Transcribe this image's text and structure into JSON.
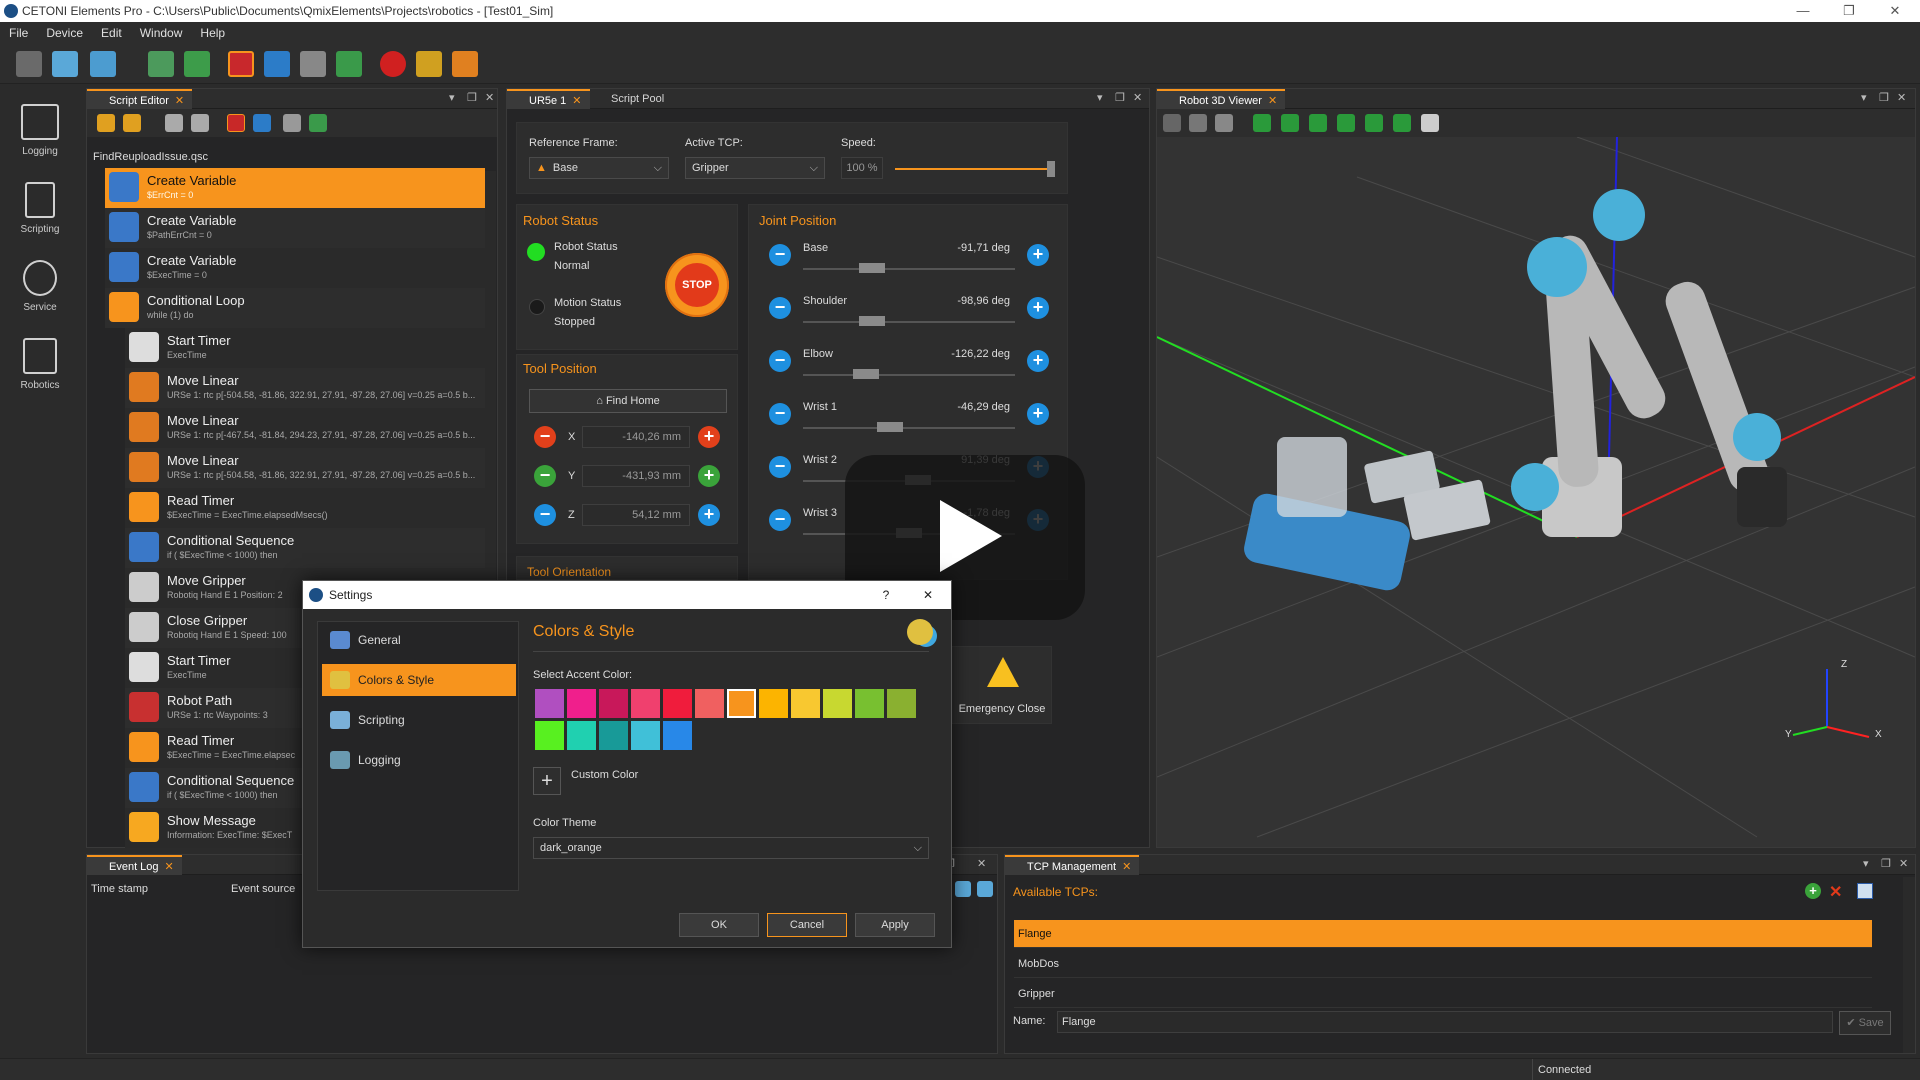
{
  "app": {
    "title": "CETONI Elements Pro - C:\\Users\\Public\\Documents\\QmixElements\\Projects\\robotics - [Test01_Sim]",
    "menu": [
      "File",
      "Device",
      "Edit",
      "Window",
      "Help"
    ],
    "status_text": "Connected"
  },
  "sidebar": {
    "items": [
      {
        "label": "Logging"
      },
      {
        "label": "Scripting"
      },
      {
        "label": "Service"
      },
      {
        "label": "Robotics"
      }
    ]
  },
  "script_editor": {
    "tab_label": "Script Editor",
    "file_name": "FindReuploadIssue.qsc",
    "items": [
      {
        "title": "Create Variable",
        "subtitle": "$ErrCnt = 0"
      },
      {
        "title": "Create Variable",
        "subtitle": "$PathErrCnt = 0"
      },
      {
        "title": "Create Variable",
        "subtitle": "$ExecTime = 0"
      },
      {
        "title": "Conditional Loop",
        "subtitle": "while (1) do"
      },
      {
        "title": "Start Timer",
        "subtitle": "ExecTime"
      },
      {
        "title": "Move Linear",
        "subtitle": "URSe 1: rtc p[-504.58, -81.86, 322.91, 27.91, -87.28, 27.06] v=0.25 a=0.5 b..."
      },
      {
        "title": "Move Linear",
        "subtitle": "URSe 1: rtc p[-467.54, -81.84, 294.23, 27.91, -87.28, 27.06] v=0.25 a=0.5 b..."
      },
      {
        "title": "Move Linear",
        "subtitle": "URSe 1: rtc p[-504.58, -81.86, 322.91, 27.91, -87.28, 27.06] v=0.25 a=0.5 b..."
      },
      {
        "title": "Read Timer",
        "subtitle": "$ExecTime = ExecTime.elapsedMsecs()"
      },
      {
        "title": "Conditional Sequence",
        "subtitle": "if ( $ExecTime < 1000) then"
      },
      {
        "title": "Move Gripper",
        "subtitle": "Robotiq Hand E 1    Position: 2"
      },
      {
        "title": "Close Gripper",
        "subtitle": "Robotiq Hand E 1    Speed: 100"
      },
      {
        "title": "Start Timer",
        "subtitle": "ExecTime"
      },
      {
        "title": "Robot Path",
        "subtitle": "URSe 1: rtc Waypoints: 3"
      },
      {
        "title": "Read Timer",
        "subtitle": "$ExecTime = ExecTime.elapsec"
      },
      {
        "title": "Conditional Sequence",
        "subtitle": "if ( $ExecTime < 1000) then"
      },
      {
        "title": "Show Message",
        "subtitle": "Information: ExecTime: $ExecT"
      }
    ]
  },
  "robot_panel": {
    "tabs": [
      "UR5e 1",
      "Script Pool"
    ],
    "reference_frame_label": "Reference Frame:",
    "reference_frame_value": "Base",
    "active_tcp_label": "Active TCP:",
    "active_tcp_value": "Gripper",
    "speed_label": "Speed:",
    "speed_value": "100 %",
    "speed_fraction": 1.0,
    "robot_status_title": "Robot Status",
    "robot_status_label": "Robot Status",
    "robot_status_value": "Normal",
    "motion_status_label": "Motion Status",
    "motion_status_value": "Stopped",
    "stop_label": "STOP",
    "tool_position_title": "Tool Position",
    "find_home_label": "Find Home",
    "tool_axes": [
      {
        "axis": "X",
        "value": "-140,26 mm"
      },
      {
        "axis": "Y",
        "value": "-431,93 mm"
      },
      {
        "axis": "Z",
        "value": "54,12 mm"
      }
    ],
    "tool_orientation_title": "Tool Orientation",
    "joint_position_title": "Joint Position",
    "joints": [
      {
        "name": "Base",
        "value": "-91,71 deg",
        "fraction": 0.3
      },
      {
        "name": "Shoulder",
        "value": "-98,96 deg",
        "fraction": 0.3
      },
      {
        "name": "Elbow",
        "value": "-126,22 deg",
        "fraction": 0.27
      },
      {
        "name": "Wrist 1",
        "value": "-46,29 deg",
        "fraction": 0.4
      },
      {
        "name": "Wrist 2",
        "value": "91,39 deg",
        "fraction": 0.55
      },
      {
        "name": "Wrist 3",
        "value": "-1,78 deg",
        "fraction": 0.5
      }
    ],
    "emergency_close_label": "Emergency Close"
  },
  "viewer": {
    "tab_label": "Robot 3D Viewer",
    "axis_labels": [
      "Z",
      "Y",
      "X"
    ]
  },
  "event_log": {
    "tab_label": "Event Log",
    "columns": [
      "Time stamp",
      "Event source"
    ]
  },
  "tcp_management": {
    "tab_label": "TCP Management",
    "available_label": "Available TCPs:",
    "rows": [
      "Flange",
      "MobDos",
      "Gripper"
    ],
    "name_label": "Name:",
    "name_value": "Flange",
    "save_label": "Save"
  },
  "settings_dialog": {
    "title": "Settings",
    "help_label": "?",
    "nav": [
      "General",
      "Colors & Style",
      "Scripting",
      "Logging"
    ],
    "heading": "Colors & Style",
    "accent_label": "Select Accent Color:",
    "accent_colors": [
      "#b04fc0",
      "#f01f8c",
      "#c8185a",
      "#f0406e",
      "#f01c3c",
      "#f06060",
      "#f7941d",
      "#fcb400",
      "#f8c830",
      "#c8d830",
      "#78c030",
      "#8ab030",
      "#58f020",
      "#20d0b0",
      "#189a98",
      "#40c0d8",
      "#2888e8"
    ],
    "selected_index": 6,
    "custom_color_label": "Custom Color",
    "theme_label": "Color Theme",
    "theme_value": "dark_orange",
    "ok_label": "OK",
    "cancel_label": "Cancel",
    "apply_label": "Apply"
  },
  "colors": {
    "accent": "#f7941d",
    "panel": "#252526",
    "blue_button": "#1e90e0"
  }
}
